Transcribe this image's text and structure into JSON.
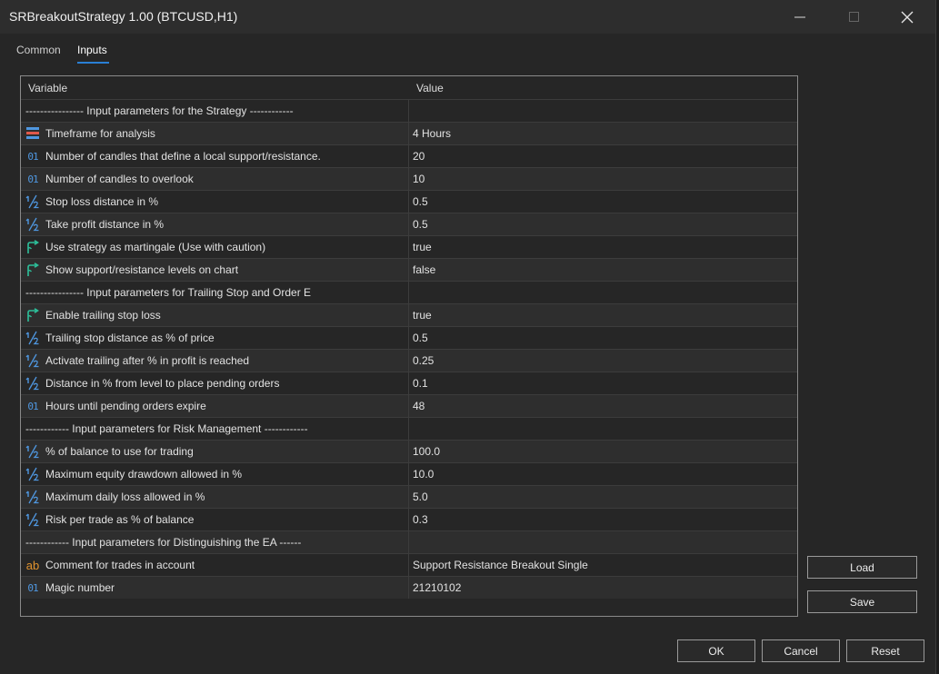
{
  "window": {
    "title": "SRBreakoutStrategy 1.00 (BTCUSD,H1)"
  },
  "tabs": [
    {
      "label": "Common"
    },
    {
      "label": "Inputs"
    }
  ],
  "grid": {
    "headers": {
      "variable": "Variable",
      "value": "Value"
    },
    "rows": [
      {
        "type": "section",
        "label": "---------------- Input parameters for the Strategy ------------",
        "value": ""
      },
      {
        "type": "param",
        "icon": "enum-icon",
        "label": "Timeframe for analysis",
        "value": "4 Hours"
      },
      {
        "type": "param",
        "icon": "integer-icon",
        "label": "Number of candles that define a local support/resistance.",
        "value": "20"
      },
      {
        "type": "param",
        "icon": "integer-icon",
        "label": "Number of candles to overlook",
        "value": "10"
      },
      {
        "type": "param",
        "icon": "fraction-icon",
        "label": "Stop loss distance in %",
        "value": "0.5"
      },
      {
        "type": "param",
        "icon": "fraction-icon",
        "label": "Take profit distance in %",
        "value": "0.5"
      },
      {
        "type": "param",
        "icon": "bool-icon",
        "label": "Use strategy as martingale (Use with caution)",
        "value": "true"
      },
      {
        "type": "param",
        "icon": "bool-icon",
        "label": "Show support/resistance levels on chart",
        "value": "false"
      },
      {
        "type": "section",
        "label": "---------------- Input parameters for Trailing Stop and Order E",
        "value": ""
      },
      {
        "type": "param",
        "icon": "bool-icon",
        "label": "Enable trailing stop loss",
        "value": "true"
      },
      {
        "type": "param",
        "icon": "fraction-icon",
        "label": "Trailing stop distance as % of price",
        "value": "0.5"
      },
      {
        "type": "param",
        "icon": "fraction-icon",
        "label": "Activate trailing after % in profit  is reached",
        "value": "0.25"
      },
      {
        "type": "param",
        "icon": "fraction-icon",
        "label": "Distance in % from level to place pending orders",
        "value": "0.1"
      },
      {
        "type": "param",
        "icon": "integer-icon",
        "label": "Hours until pending orders expire",
        "value": "48"
      },
      {
        "type": "section",
        "label": "------------ Input parameters for Risk Management ------------",
        "value": ""
      },
      {
        "type": "param",
        "icon": "fraction-icon",
        "label": "% of balance to use for trading",
        "value": "100.0"
      },
      {
        "type": "param",
        "icon": "fraction-icon",
        "label": "Maximum equity drawdown allowed in %",
        "value": "10.0"
      },
      {
        "type": "param",
        "icon": "fraction-icon",
        "label": "Maximum daily loss allowed in %",
        "value": "5.0"
      },
      {
        "type": "param",
        "icon": "fraction-icon",
        "label": "Risk per trade as % of balance",
        "value": "0.3"
      },
      {
        "type": "section",
        "label": "------------ Input parameters for Distinguishing the EA ------",
        "value": ""
      },
      {
        "type": "param",
        "icon": "string-icon",
        "label": "Comment for trades in account",
        "value": "Support Resistance Breakout Single"
      },
      {
        "type": "param",
        "icon": "integer-icon",
        "label": "Magic number",
        "value": "21210102"
      }
    ]
  },
  "side_buttons": {
    "load": "Load",
    "save": "Save"
  },
  "footer_buttons": {
    "ok": "OK",
    "cancel": "Cancel",
    "reset": "Reset"
  },
  "icon_glyphs": {
    "integer": "01",
    "fraction": "½",
    "string": "ab"
  },
  "colors": {
    "accent": "#2a7fd4",
    "integer_icon": "#4f97e0",
    "bool_icon": "#2dbf9a",
    "string_icon": "#e0922e"
  }
}
